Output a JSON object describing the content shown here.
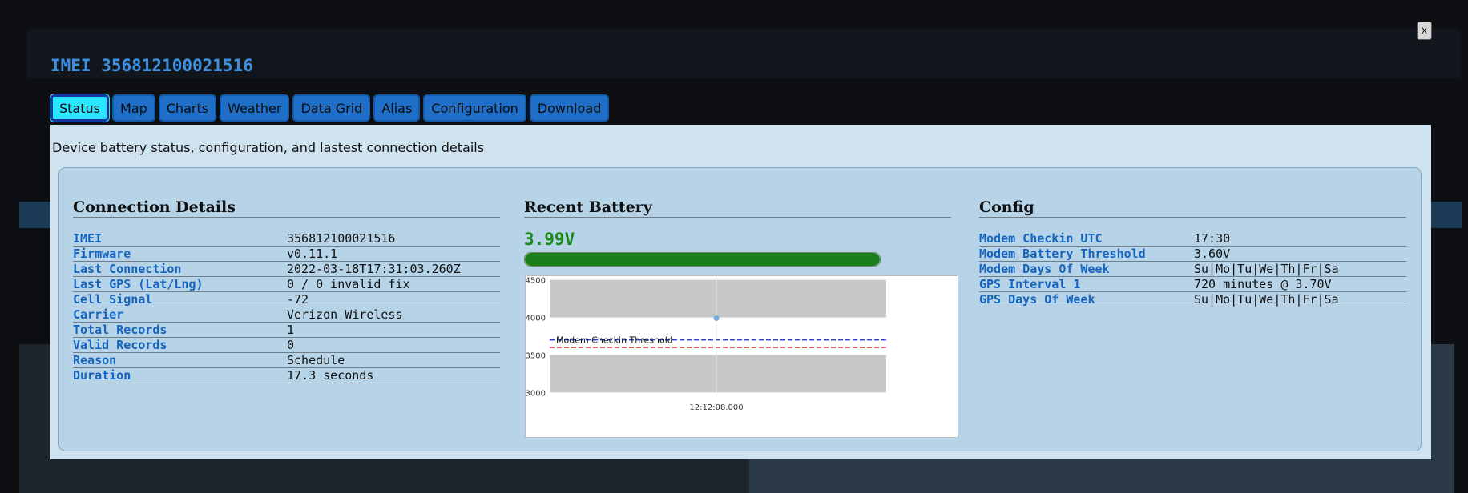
{
  "modal": {
    "close_label": "x",
    "title": "IMEI 356812100021516",
    "tabs": [
      {
        "label": "Status",
        "active": true
      },
      {
        "label": "Map"
      },
      {
        "label": "Charts"
      },
      {
        "label": "Weather"
      },
      {
        "label": "Data Grid"
      },
      {
        "label": "Alias"
      },
      {
        "label": "Configuration"
      },
      {
        "label": "Download"
      }
    ],
    "description": "Device battery status, configuration, and lastest connection details"
  },
  "connection_details": {
    "title": "Connection Details",
    "rows": [
      {
        "key": "IMEI",
        "value": "356812100021516"
      },
      {
        "key": "Firmware",
        "value": "v0.11.1"
      },
      {
        "key": "Last Connection",
        "value": "2022-03-18T17:31:03.260Z"
      },
      {
        "key": "Last GPS (Lat/Lng)",
        "value": "0 / 0 invalid fix"
      },
      {
        "key": "Cell Signal",
        "value": "-72"
      },
      {
        "key": "Carrier",
        "value": "Verizon Wireless"
      },
      {
        "key": "Total Records",
        "value": "1"
      },
      {
        "key": "Valid Records",
        "value": "0"
      },
      {
        "key": "Reason",
        "value": "Schedule"
      },
      {
        "key": "Duration",
        "value": "17.3 seconds"
      }
    ]
  },
  "recent_battery": {
    "title": "Recent Battery",
    "value": "3.99V",
    "fill_fraction": 1.0,
    "colors": {
      "fill": "#1b7f1b",
      "text": "#1a8a1a"
    }
  },
  "config": {
    "title": "Config",
    "rows": [
      {
        "key": "Modem Checkin UTC",
        "value": "17:30"
      },
      {
        "key": "Modem Battery Threshold",
        "value": "3.60V"
      },
      {
        "key": "Modem Days Of Week",
        "value": "Su|Mo|Tu|We|Th|Fr|Sa"
      },
      {
        "key": "GPS Interval 1",
        "value": "720 minutes @ 3.70V"
      },
      {
        "key": "GPS Days Of Week",
        "value": "Su|Mo|Tu|We|Th|Fr|Sa"
      }
    ]
  },
  "chart_data": {
    "type": "scatter",
    "title": "",
    "xlabel": "",
    "ylabel": "",
    "ylim": [
      2950,
      4550
    ],
    "yticks": [
      3000,
      3500,
      4000,
      4500
    ],
    "x_tick_label": "12:12:08.000",
    "points": [
      {
        "x": "12:12:08.000",
        "y": 3990
      }
    ],
    "threshold_lines": [
      {
        "name": "Modem Checkin Threshold",
        "value": 3700,
        "color": "#2b3fd0",
        "style": "dashed"
      },
      {
        "value": 3600,
        "color": "#d42020",
        "style": "dashed"
      }
    ],
    "bands": [
      {
        "from": 4000,
        "to": 4500,
        "color": "#c8c8c8"
      },
      {
        "from": 3000,
        "to": 3500,
        "color": "#c8c8c8"
      }
    ],
    "colors": {
      "point": "#7aaee0",
      "grid": "#dddddd"
    }
  }
}
